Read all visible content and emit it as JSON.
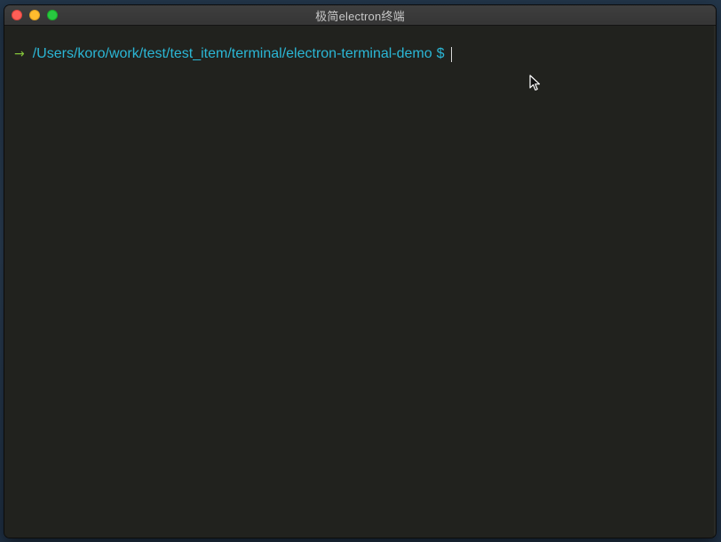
{
  "window": {
    "title": "极简electron终端"
  },
  "terminal": {
    "prompt_symbol": "→",
    "cwd": "/Users/koro/work/test/test_item/terminal/electron-terminal-demo",
    "prompt_char": "$"
  },
  "colors": {
    "background": "#21221e",
    "path": "#2bb7d6",
    "arrow": "#84c43a",
    "titlebar": "#3a3a3a"
  },
  "icons": {
    "close": "close-dot-icon",
    "minimize": "minimize-dot-icon",
    "maximize": "maximize-dot-icon",
    "pointer": "mouse-pointer-icon"
  }
}
